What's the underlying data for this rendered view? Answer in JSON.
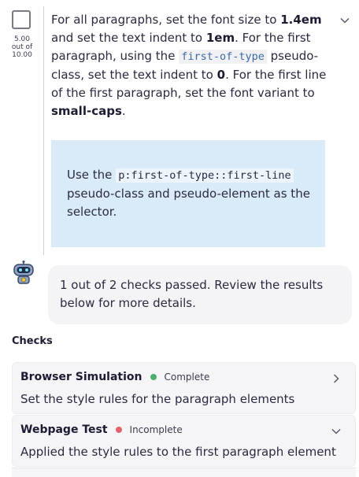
{
  "task": {
    "score_line1": "5.00",
    "score_line2": "out of",
    "score_line3": "10.00",
    "desc": {
      "t1": "For all paragraphs, set the font size to ",
      "b1": "1.4em",
      "t2": " and set the text indent to ",
      "b2": "1em",
      "t3": ". For the first paragraph, using the ",
      "c1": "first-of-type",
      "t4": " pseudo-class, set the text indent to ",
      "b3": "0",
      "t5": ". For the first line of the first paragraph, set the font variant to ",
      "b4": "small-caps",
      "t6": "."
    },
    "hint": {
      "t1": "Use the ",
      "c1": "p:first-of-type::first-line",
      "t2": " pseudo-class and pseudo-element as the selector."
    }
  },
  "feedback": {
    "message": "1 out of 2 checks passed. Review the results below for more details."
  },
  "checks": {
    "title": "Checks",
    "items": [
      {
        "title": "Browser Simulation",
        "status": "Complete",
        "status_color": "#4caf6e",
        "desc": "Set the style rules for the paragraph elements"
      },
      {
        "title": "Webpage Test",
        "status": "Incomplete",
        "status_color": "#e4606d",
        "desc": "Applied the style rules to the first paragraph element"
      }
    ]
  },
  "icons": {
    "checkbox": "checkbox-icon",
    "expand": "chevron-down-icon",
    "bot": "robot-avatar-icon",
    "open": "chevron-right-icon"
  },
  "colors": {
    "hint_bg": "#d9ebf8",
    "card_bg": "#f5f5f7",
    "code": "#3b6aa3"
  }
}
